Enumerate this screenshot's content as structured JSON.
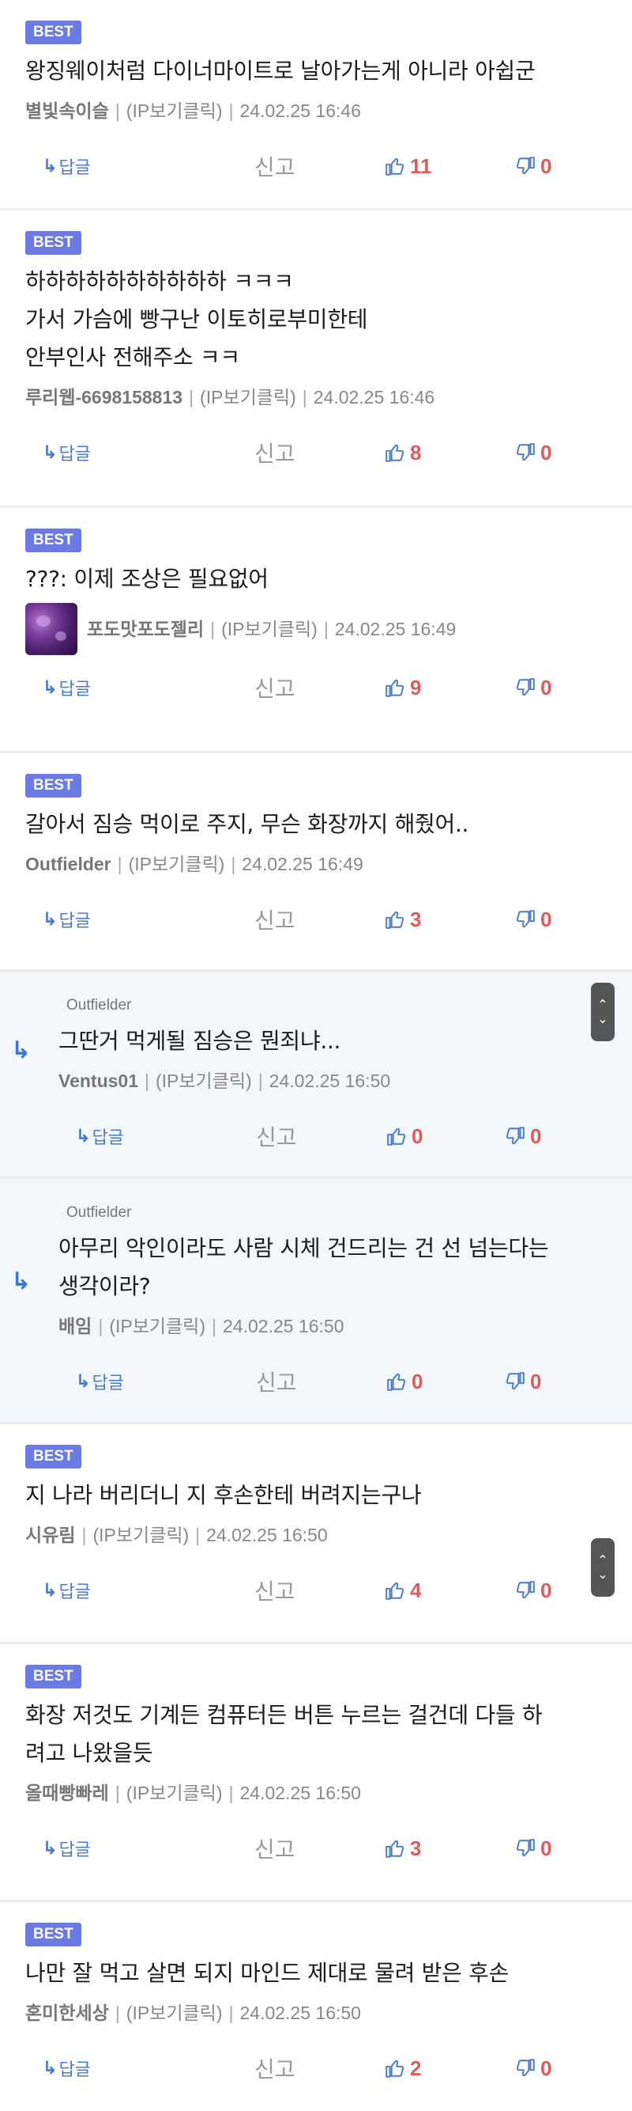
{
  "labels": {
    "best": "BEST",
    "reply": "답글",
    "report": "신고",
    "ip": "(IP보기클릭)"
  },
  "comments": [
    {
      "text": [
        "왕징웨이처럼 다이너마이트로 날아가는게 아니라 아쉽군"
      ],
      "nick": "별빛속이슬",
      "date": "24.02.25 16:46",
      "likes": "11",
      "dislikes": "0"
    },
    {
      "text": [
        "하하하하하하하하하하 ㅋㅋㅋ",
        "가서 가슴에 빵구난 이토히로부미한테",
        "안부인사 전해주소 ㅋㅋ"
      ],
      "nick": "루리웹-6698158813",
      "date": "24.02.25 16:46",
      "likes": "8",
      "dislikes": "0"
    },
    {
      "text": [
        "???: 이제 조상은 필요없어"
      ],
      "nick": "포도맛포도젤리",
      "date": "24.02.25 16:49",
      "likes": "9",
      "dislikes": "0"
    },
    {
      "text": [
        "갈아서 짐승 먹이로 주지, 무슨 화장까지 해줬어.."
      ],
      "nick": "Outfielder",
      "date": "24.02.25 16:49",
      "likes": "3",
      "dislikes": "0"
    },
    {
      "reply_to": "Outfielder",
      "text": [
        "그딴거 먹게될 짐승은 뭔죄냐..."
      ],
      "nick": "Ventus01",
      "date": "24.02.25 16:50",
      "likes": "0",
      "dislikes": "0"
    },
    {
      "reply_to": "Outfielder",
      "text": [
        "아무리 악인이라도 사람 시체 건드리는 건 선 넘는다는",
        "생각이라?"
      ],
      "nick": "배임",
      "date": "24.02.25 16:50",
      "likes": "0",
      "dislikes": "0"
    },
    {
      "text": [
        "지 나라 버리더니 지 후손한테 버려지는구나"
      ],
      "nick": "시유림",
      "date": "24.02.25 16:50",
      "likes": "4",
      "dislikes": "0"
    },
    {
      "text": [
        "화장 저것도 기계든 컴퓨터든 버튼 누르는 걸건데 다들 하",
        "려고 나왔을듯"
      ],
      "nick": "올때빵빠레",
      "date": "24.02.25 16:50",
      "likes": "3",
      "dislikes": "0"
    },
    {
      "text": [
        "나만 잘 먹고 살면 되지 마인드 제대로 물려 받은 후손"
      ],
      "nick": "혼미한세상",
      "date": "24.02.25 16:50",
      "likes": "2",
      "dislikes": "0"
    }
  ],
  "colors": {
    "best_badge": "#6b7be3",
    "reply_bg": "#f3f6fb",
    "like": "#e05a5a",
    "link": "#4a7bd0"
  },
  "icons": {
    "like": "thumbs-up-icon",
    "dislike": "thumbs-down-icon",
    "reply": "reply-arrow-icon",
    "avatar": "grape-jelly-avatar"
  }
}
